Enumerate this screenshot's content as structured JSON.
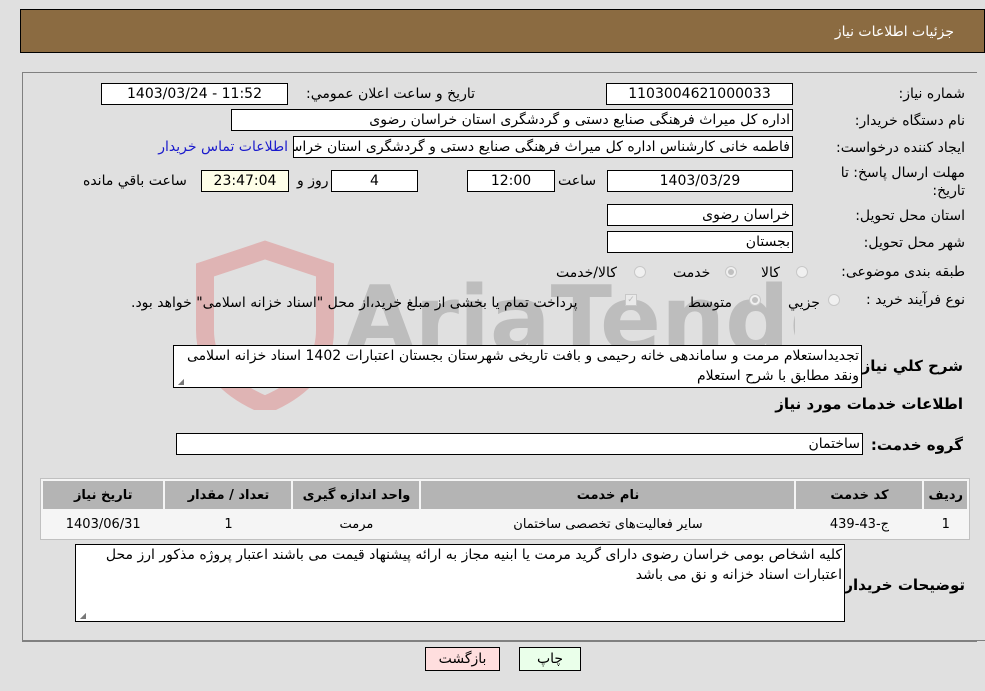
{
  "header": {
    "title": "جزئیات اطلاعات نیاز"
  },
  "form": {
    "need_number": {
      "label": "شماره نیاز:",
      "value": "1103004621000033"
    },
    "announce_datetime": {
      "label": "تاريخ و ساعت اعلان عمومي:",
      "value": "1403/03/24 - 11:52"
    },
    "buyer_org": {
      "label": "نام دستگاه خريدار:",
      "value": "اداره کل میراث فرهنگی  صنایع دستی و گردشگری استان خراسان رضوی"
    },
    "requester": {
      "label": "ايجاد کننده درخواست:",
      "value": "فاطمه خانی کارشناس اداره کل میراث فرهنگی  صنایع دستی و گردشگری استان خراسان رضوی",
      "contact_link": "اطلاعات تماس خريدار"
    },
    "deadline": {
      "label": "مهلت ارسال پاسخ: تا تاريخ:",
      "date": "1403/03/29",
      "time_label": "ساعت",
      "time": "12:00",
      "days": "4",
      "days_label": "روز و",
      "remaining": "23:47:04",
      "remaining_label": "ساعت باقي مانده"
    },
    "delivery_province": {
      "label": "استان محل تحويل:",
      "value": "خراسان رضوی"
    },
    "delivery_city": {
      "label": "شهر محل تحويل:",
      "value": "بجستان"
    },
    "category": {
      "label": "طبقه بندی موضوعی:",
      "options": [
        "کالا",
        "خدمت",
        "کالا/خدمت"
      ],
      "selected": "خدمت"
    },
    "purchase_type": {
      "label": "نوع فرآيند خريد :",
      "options": [
        "جزيي",
        "متوسط"
      ],
      "selected": "متوسط",
      "treasury_note": "پرداخت تمام يا بخشی از مبلغ خريد،از محل \"اسناد خزانه اسلامی\" خواهد بود.",
      "treasury_checked": true
    }
  },
  "description": {
    "label": "شرح کلي نياز:",
    "value": "تجديداستعلام مرمت و ساماندهی خانه رحيمی و بافت تاريخی شهرستان بجستان اعتبارات 1402 اسناد خزانه اسلامی ونقد مطابق با شرح استعلام"
  },
  "services_section": {
    "title": "اطلاعات خدمات مورد نياز",
    "group_label": "گروه خدمت:",
    "group_value": "ساختمان"
  },
  "table": {
    "headers": [
      "رديف",
      "کد خدمت",
      "نام خدمت",
      "واحد اندازه گيری",
      "تعداد / مقدار",
      "تاريخ نياز"
    ],
    "rows": [
      [
        "1",
        "ج-43-439",
        "ساير فعاليت‌های تخصصی ساختمان",
        "مرمت",
        "1",
        "1403/06/31"
      ]
    ]
  },
  "buyer_notes": {
    "label": "توضيحات خريدار:",
    "value": "کليه اشخاص بومی خراسان رضوی دارای گريد مرمت يا ابنيه مجاز به ارائه پيشنهاد قيمت می باشند اعتبار پروژه مذکور ارز محل اعتبارات اسناد خزانه و نق می باشد"
  },
  "buttons": {
    "print": "چاپ",
    "back": "بازگشت"
  },
  "colors": {
    "header_bg": "#8b6b41",
    "print_bg": "#eaffea",
    "back_bg": "#ffdede",
    "link": "#1a1acc"
  }
}
